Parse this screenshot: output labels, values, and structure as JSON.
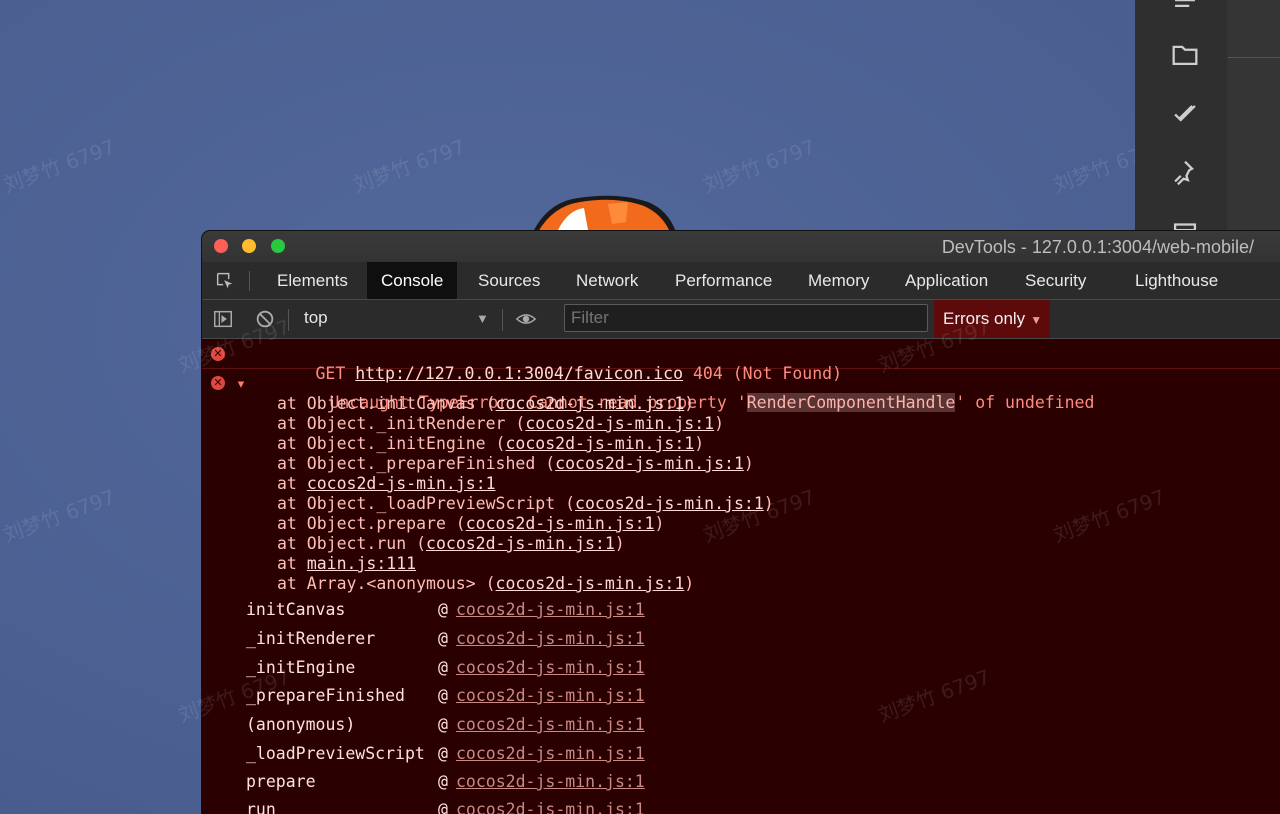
{
  "watermark_text": "刘梦竹 6797",
  "devtools": {
    "window_title": "DevTools - 127.0.0.1:3004/web-mobile/",
    "tabs": [
      "Elements",
      "Console",
      "Sources",
      "Network",
      "Performance",
      "Memory",
      "Application",
      "Security",
      "Lighthouse"
    ],
    "active_tab": "Console",
    "toolbar": {
      "context": "top",
      "filter_placeholder": "Filter",
      "levels_label": "Errors only"
    }
  },
  "console": {
    "get_error": {
      "prefix": "GET ",
      "url": "http://127.0.0.1:3004/favicon.ico",
      "status": " 404 (Not Found)"
    },
    "type_error": {
      "prefix": "Uncaught TypeError: Cannot read property '",
      "property": "RenderComponentHandle",
      "suffix": "' of undefined",
      "stack": [
        {
          "pre": "at Object.initCanvas (",
          "link": "cocos2d-js-min.js:1",
          "post": ")"
        },
        {
          "pre": "at Object._initRenderer (",
          "link": "cocos2d-js-min.js:1",
          "post": ")"
        },
        {
          "pre": "at Object._initEngine (",
          "link": "cocos2d-js-min.js:1",
          "post": ")"
        },
        {
          "pre": "at Object._prepareFinished (",
          "link": "cocos2d-js-min.js:1",
          "post": ")"
        },
        {
          "pre": "at ",
          "link": "cocos2d-js-min.js:1",
          "post": ""
        },
        {
          "pre": "at Object._loadPreviewScript (",
          "link": "cocos2d-js-min.js:1",
          "post": ")"
        },
        {
          "pre": "at Object.prepare (",
          "link": "cocos2d-js-min.js:1",
          "post": ")"
        },
        {
          "pre": "at Object.run (",
          "link": "cocos2d-js-min.js:1",
          "post": ")"
        },
        {
          "pre": "at ",
          "link": "main.js:111",
          "post": ""
        },
        {
          "pre": "at Array.<anonymous> (",
          "link": "cocos2d-js-min.js:1",
          "post": ")"
        }
      ]
    },
    "call_stack": [
      {
        "fn": "initCanvas",
        "at": "@",
        "link": "cocos2d-js-min.js:1"
      },
      {
        "fn": "_initRenderer",
        "at": "@",
        "link": "cocos2d-js-min.js:1"
      },
      {
        "fn": "_initEngine",
        "at": "@",
        "link": "cocos2d-js-min.js:1"
      },
      {
        "fn": "_prepareFinished",
        "at": "@",
        "link": "cocos2d-js-min.js:1"
      },
      {
        "fn": "(anonymous)",
        "at": "@",
        "link": "cocos2d-js-min.js:1"
      },
      {
        "fn": "_loadPreviewScript",
        "at": "@",
        "link": "cocos2d-js-min.js:1"
      },
      {
        "fn": "prepare",
        "at": "@",
        "link": "cocos2d-js-min.js:1"
      },
      {
        "fn": "run",
        "at": "@",
        "link": "cocos2d-js-min.js:1"
      }
    ]
  },
  "colors": {
    "error_background": "#2a0000",
    "error_text": "#ff8c80",
    "levels_background": "#5c0a0a"
  }
}
